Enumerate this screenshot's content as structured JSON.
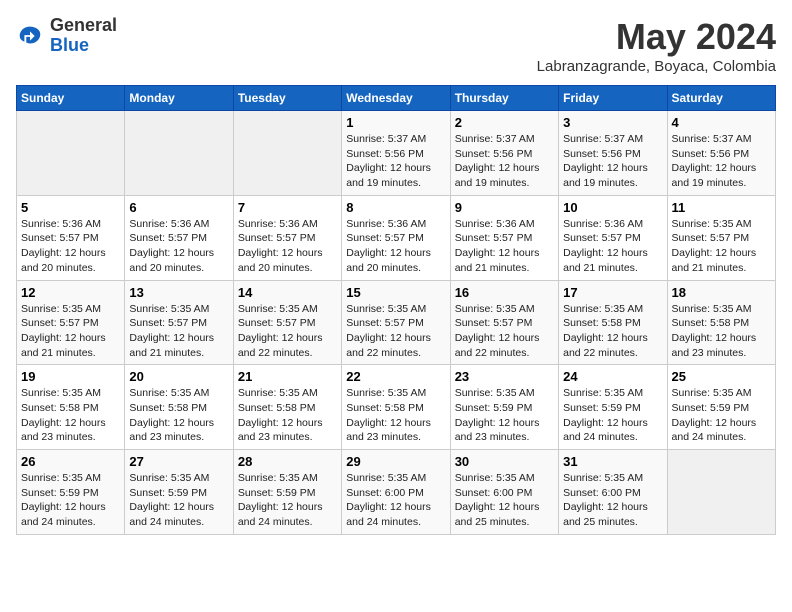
{
  "logo": {
    "general": "General",
    "blue": "Blue"
  },
  "title": "May 2024",
  "location": "Labranzagrande, Boyaca, Colombia",
  "days_of_week": [
    "Sunday",
    "Monday",
    "Tuesday",
    "Wednesday",
    "Thursday",
    "Friday",
    "Saturday"
  ],
  "weeks": [
    [
      {
        "day": "",
        "info": ""
      },
      {
        "day": "",
        "info": ""
      },
      {
        "day": "",
        "info": ""
      },
      {
        "day": "1",
        "info": "Sunrise: 5:37 AM\nSunset: 5:56 PM\nDaylight: 12 hours and 19 minutes."
      },
      {
        "day": "2",
        "info": "Sunrise: 5:37 AM\nSunset: 5:56 PM\nDaylight: 12 hours and 19 minutes."
      },
      {
        "day": "3",
        "info": "Sunrise: 5:37 AM\nSunset: 5:56 PM\nDaylight: 12 hours and 19 minutes."
      },
      {
        "day": "4",
        "info": "Sunrise: 5:37 AM\nSunset: 5:56 PM\nDaylight: 12 hours and 19 minutes."
      }
    ],
    [
      {
        "day": "5",
        "info": "Sunrise: 5:36 AM\nSunset: 5:57 PM\nDaylight: 12 hours and 20 minutes."
      },
      {
        "day": "6",
        "info": "Sunrise: 5:36 AM\nSunset: 5:57 PM\nDaylight: 12 hours and 20 minutes."
      },
      {
        "day": "7",
        "info": "Sunrise: 5:36 AM\nSunset: 5:57 PM\nDaylight: 12 hours and 20 minutes."
      },
      {
        "day": "8",
        "info": "Sunrise: 5:36 AM\nSunset: 5:57 PM\nDaylight: 12 hours and 20 minutes."
      },
      {
        "day": "9",
        "info": "Sunrise: 5:36 AM\nSunset: 5:57 PM\nDaylight: 12 hours and 21 minutes."
      },
      {
        "day": "10",
        "info": "Sunrise: 5:36 AM\nSunset: 5:57 PM\nDaylight: 12 hours and 21 minutes."
      },
      {
        "day": "11",
        "info": "Sunrise: 5:35 AM\nSunset: 5:57 PM\nDaylight: 12 hours and 21 minutes."
      }
    ],
    [
      {
        "day": "12",
        "info": "Sunrise: 5:35 AM\nSunset: 5:57 PM\nDaylight: 12 hours and 21 minutes."
      },
      {
        "day": "13",
        "info": "Sunrise: 5:35 AM\nSunset: 5:57 PM\nDaylight: 12 hours and 21 minutes."
      },
      {
        "day": "14",
        "info": "Sunrise: 5:35 AM\nSunset: 5:57 PM\nDaylight: 12 hours and 22 minutes."
      },
      {
        "day": "15",
        "info": "Sunrise: 5:35 AM\nSunset: 5:57 PM\nDaylight: 12 hours and 22 minutes."
      },
      {
        "day": "16",
        "info": "Sunrise: 5:35 AM\nSunset: 5:57 PM\nDaylight: 12 hours and 22 minutes."
      },
      {
        "day": "17",
        "info": "Sunrise: 5:35 AM\nSunset: 5:58 PM\nDaylight: 12 hours and 22 minutes."
      },
      {
        "day": "18",
        "info": "Sunrise: 5:35 AM\nSunset: 5:58 PM\nDaylight: 12 hours and 23 minutes."
      }
    ],
    [
      {
        "day": "19",
        "info": "Sunrise: 5:35 AM\nSunset: 5:58 PM\nDaylight: 12 hours and 23 minutes."
      },
      {
        "day": "20",
        "info": "Sunrise: 5:35 AM\nSunset: 5:58 PM\nDaylight: 12 hours and 23 minutes."
      },
      {
        "day": "21",
        "info": "Sunrise: 5:35 AM\nSunset: 5:58 PM\nDaylight: 12 hours and 23 minutes."
      },
      {
        "day": "22",
        "info": "Sunrise: 5:35 AM\nSunset: 5:58 PM\nDaylight: 12 hours and 23 minutes."
      },
      {
        "day": "23",
        "info": "Sunrise: 5:35 AM\nSunset: 5:59 PM\nDaylight: 12 hours and 23 minutes."
      },
      {
        "day": "24",
        "info": "Sunrise: 5:35 AM\nSunset: 5:59 PM\nDaylight: 12 hours and 24 minutes."
      },
      {
        "day": "25",
        "info": "Sunrise: 5:35 AM\nSunset: 5:59 PM\nDaylight: 12 hours and 24 minutes."
      }
    ],
    [
      {
        "day": "26",
        "info": "Sunrise: 5:35 AM\nSunset: 5:59 PM\nDaylight: 12 hours and 24 minutes."
      },
      {
        "day": "27",
        "info": "Sunrise: 5:35 AM\nSunset: 5:59 PM\nDaylight: 12 hours and 24 minutes."
      },
      {
        "day": "28",
        "info": "Sunrise: 5:35 AM\nSunset: 5:59 PM\nDaylight: 12 hours and 24 minutes."
      },
      {
        "day": "29",
        "info": "Sunrise: 5:35 AM\nSunset: 6:00 PM\nDaylight: 12 hours and 24 minutes."
      },
      {
        "day": "30",
        "info": "Sunrise: 5:35 AM\nSunset: 6:00 PM\nDaylight: 12 hours and 25 minutes."
      },
      {
        "day": "31",
        "info": "Sunrise: 5:35 AM\nSunset: 6:00 PM\nDaylight: 12 hours and 25 minutes."
      },
      {
        "day": "",
        "info": ""
      }
    ]
  ]
}
